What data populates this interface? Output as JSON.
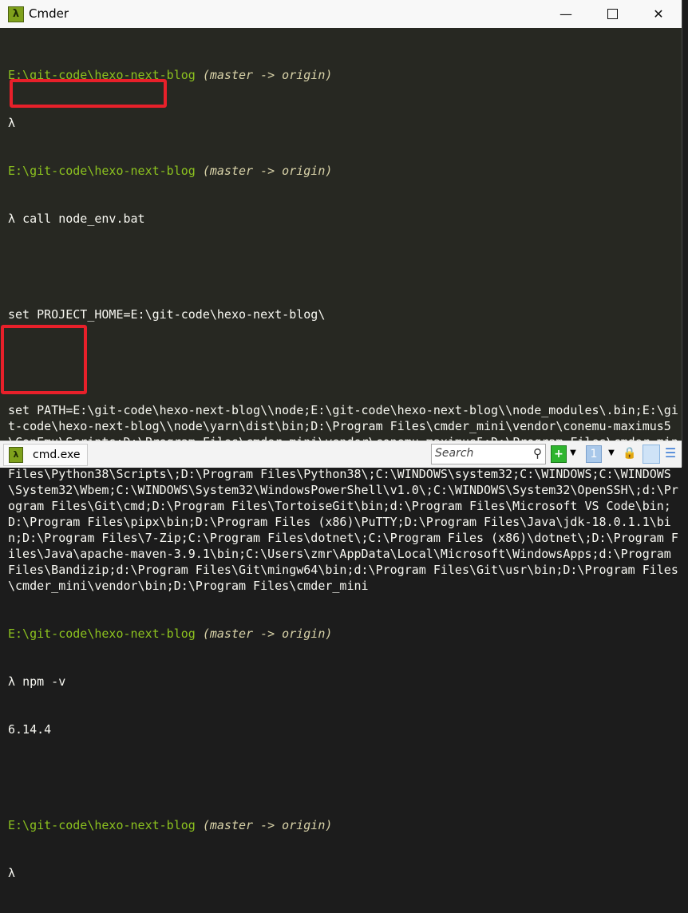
{
  "window": {
    "title": "Cmder",
    "app_icon": "lambda-icon",
    "controls": [
      "minimize",
      "maximize",
      "close"
    ]
  },
  "terminal": {
    "prompt_symbol": "λ",
    "prompt_path": "E:\\git-code\\hexo-next-blog",
    "prompt_branch": "(master -> origin)",
    "cmd1": "call node_env.bat",
    "set_project_home": "set PROJECT_HOME=E:\\git-code\\hexo-next-blog\\",
    "set_path": "set PATH=E:\\git-code\\hexo-next-blog\\\\node;E:\\git-code\\hexo-next-blog\\\\node_modules\\.bin;E:\\git-code\\hexo-next-blog\\\\node\\yarn\\dist\\bin;D:\\Program Files\\cmder_mini\\vendor\\conemu-maximus5\\ConEmu\\Scripts;D:\\Program Files\\cmder_mini\\vendor\\conemu-maximus5;D:\\Program Files\\cmder_mini\\vendor\\conemu-maximus5\\ConEmu;C:\\Program Files\\Common Files\\Oracle\\Java\\javapath;D:\\Program Files\\Python38\\Scripts\\;D:\\Program Files\\Python38\\;C:\\WINDOWS\\system32;C:\\WINDOWS;C:\\WINDOWS\\System32\\Wbem;C:\\WINDOWS\\System32\\WindowsPowerShell\\v1.0\\;C:\\WINDOWS\\System32\\OpenSSH\\;d:\\Program Files\\Git\\cmd;D:\\Program Files\\TortoiseGit\\bin;d:\\Program Files\\Microsoft VS Code\\bin;D:\\Program Files\\pipx\\bin;D:\\Program Files (x86)\\PuTTY;D:\\Program Files\\Java\\jdk-18.0.1.1\\bin;D:\\Program Files\\7-Zip;C:\\Program Files\\dotnet\\;C:\\Program Files (x86)\\dotnet\\;D:\\Program Files\\Java\\apache-maven-3.9.1\\bin;C:\\Users\\zmr\\AppData\\Local\\Microsoft\\WindowsApps;d:\\Program Files\\Bandizip;d:\\Program Files\\Git\\mingw64\\bin;d:\\Program Files\\Git\\usr\\bin;D:\\Program Files\\cmder_mini\\vendor\\bin;D:\\Program Files\\cmder_mini",
    "cmd2": "npm -v",
    "npm_version": "6.14.4",
    "highlight_color": "#e8202a"
  },
  "statusbar": {
    "tab_label": "cmd.exe",
    "search_placeholder": "Search",
    "icons": [
      "search-icon",
      "new-console-icon",
      "dropdown-icon",
      "console-list-icon",
      "dropdown-icon",
      "lock-icon",
      "split-view-icon",
      "menu-icon"
    ]
  }
}
